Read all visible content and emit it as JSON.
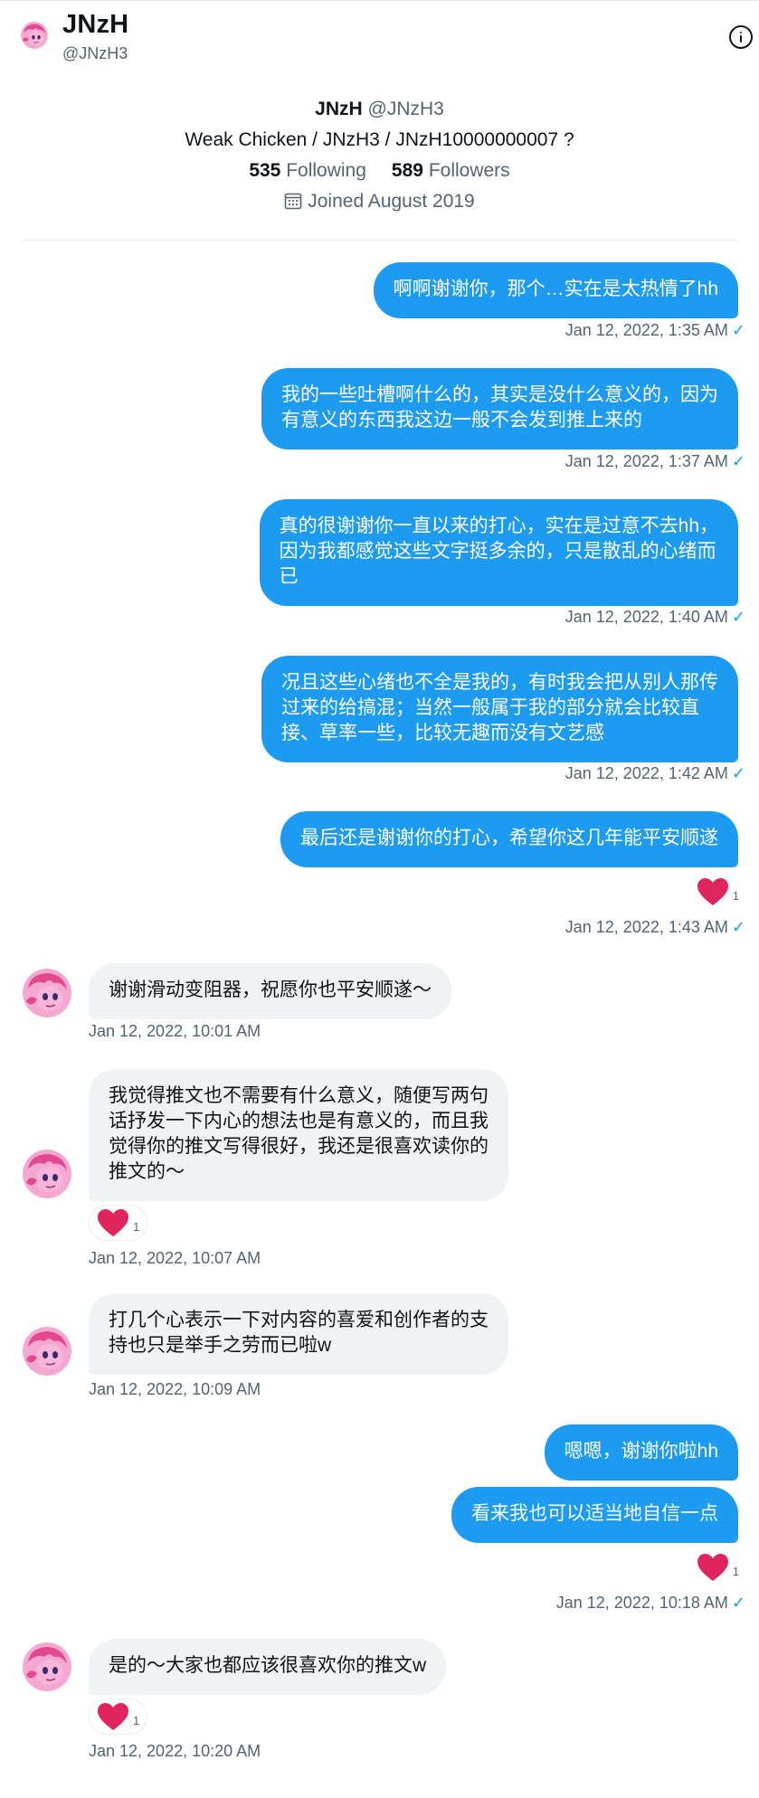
{
  "header": {
    "name": "JNzH",
    "handle": "@JNzH3"
  },
  "profile": {
    "name": "JNzH",
    "handle": "@JNzH3",
    "bio": "Weak Chicken / JNzH3 / JNzH10000000007 ?",
    "following_count": "535",
    "following_label": "Following",
    "followers_count": "589",
    "followers_label": "Followers",
    "joined": "Joined August 2019"
  },
  "messages": [
    {
      "dir": "out",
      "lines": [
        "啊啊谢谢你，那个…实在是太热情了hh"
      ],
      "time": "Jan 12, 2022, 1:35 AM",
      "check": "✓"
    },
    {
      "dir": "out",
      "lines": [
        "我的一些吐槽啊什么的，其实是没什么意义的，因为",
        "有意义的东西我这边一般不会发到推上来的"
      ],
      "time": "Jan 12, 2022, 1:37 AM",
      "check": "✓"
    },
    {
      "dir": "out",
      "lines": [
        "真的很谢谢你一直以来的打心，实在是过意不去hh，",
        "因为我都感觉这些文字挺多余的，只是散乱的心绪而",
        "已"
      ],
      "time": "Jan 12, 2022, 1:40 AM",
      "check": "✓"
    },
    {
      "dir": "out",
      "lines": [
        "况且这些心绪也不全是我的，有时我会把从别人那传",
        "过来的给搞混；当然一般属于我的部分就会比较直",
        "接、草率一些，比较无趣而没有文艺感"
      ],
      "time": "Jan 12, 2022, 1:42 AM",
      "check": "✓"
    },
    {
      "dir": "out",
      "lines": [
        "最后还是谢谢你的打心，希望你这几年能平安顺遂"
      ],
      "reaction_count": "1",
      "time": "Jan 12, 2022, 1:43 AM",
      "check": "✓"
    },
    {
      "dir": "in",
      "lines": [
        "谢谢滑动变阻器，祝愿你也平安顺遂～"
      ],
      "time": "Jan 12, 2022, 10:01 AM"
    },
    {
      "dir": "in",
      "lines": [
        "我觉得推文也不需要有什么意义，随便写两句",
        "话抒发一下内心的想法也是有意义的，而且我",
        "觉得你的推文写得很好，我还是很喜欢读你的",
        "推文的～"
      ],
      "reaction_count": "1",
      "time": "Jan 12, 2022, 10:07 AM"
    },
    {
      "dir": "in",
      "lines": [
        "打几个心表示一下对内容的喜爱和创作者的支",
        "持也只是举手之劳而已啦w"
      ],
      "time": "Jan 12, 2022, 10:09 AM"
    },
    {
      "dir": "out",
      "lines": [
        "嗯嗯，谢谢你啦hh"
      ]
    },
    {
      "dir": "out",
      "lines": [
        "看来我也可以适当地自信一点"
      ],
      "reaction_count": "1",
      "time": "Jan 12, 2022, 10:18 AM",
      "check": "✓"
    },
    {
      "dir": "in",
      "lines": [
        "是的～大家也都应该很喜欢你的推文w"
      ],
      "reaction_count": "1",
      "time": "Jan 12, 2022, 10:20 AM"
    }
  ],
  "colors": {
    "accent": "#1d9bf0",
    "incoming_bubble": "#eff3f4",
    "heart": "#f91880",
    "secondary_text": "#536471"
  },
  "icons": {
    "info": "info-circle-icon",
    "calendar": "calendar-icon",
    "heart": "heart-icon",
    "check": "check-icon"
  }
}
